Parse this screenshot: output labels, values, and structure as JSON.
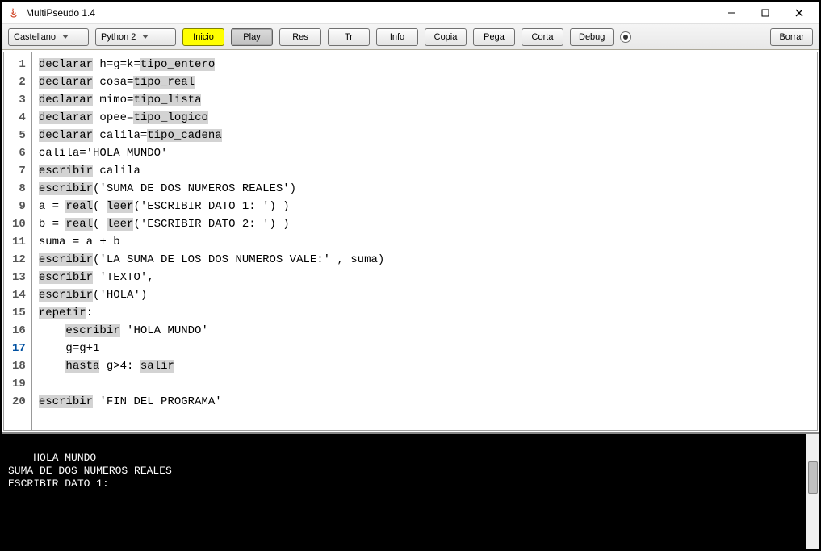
{
  "window": {
    "title": "MultiPseudo 1.4"
  },
  "toolbar": {
    "language": "Castellano",
    "interpreter": "Python 2",
    "inicio": "Inicio",
    "play": "Play",
    "res": "Res",
    "tr": "Tr",
    "info": "Info",
    "copia": "Copia",
    "pega": "Pega",
    "corta": "Corta",
    "debug": "Debug",
    "borrar": "Borrar"
  },
  "code": {
    "lines": [
      {
        "n": "1",
        "segs": [
          [
            "declarar",
            "kw"
          ],
          [
            " h=g=k=",
            ""
          ],
          [
            "tipo_entero",
            "kw"
          ]
        ]
      },
      {
        "n": "2",
        "segs": [
          [
            "declarar",
            "kw"
          ],
          [
            " cosa=",
            ""
          ],
          [
            "tipo_real",
            "kw"
          ]
        ]
      },
      {
        "n": "3",
        "segs": [
          [
            "declarar",
            "kw"
          ],
          [
            " mimo=",
            ""
          ],
          [
            "tipo_lista",
            "kw"
          ]
        ]
      },
      {
        "n": "4",
        "segs": [
          [
            "declarar",
            "kw"
          ],
          [
            " opee=",
            ""
          ],
          [
            "tipo_logico",
            "kw"
          ]
        ]
      },
      {
        "n": "5",
        "segs": [
          [
            "declarar",
            "kw"
          ],
          [
            " calila=",
            ""
          ],
          [
            "tipo_cadena",
            "kw"
          ]
        ]
      },
      {
        "n": "6",
        "segs": [
          [
            "calila='HOLA MUNDO'",
            ""
          ]
        ]
      },
      {
        "n": "7",
        "segs": [
          [
            "escribir",
            "kw"
          ],
          [
            " calila",
            ""
          ]
        ]
      },
      {
        "n": "8",
        "segs": [
          [
            "escribir",
            "kw"
          ],
          [
            "('SUMA DE DOS NUMEROS REALES')",
            ""
          ]
        ]
      },
      {
        "n": "9",
        "segs": [
          [
            "a = ",
            ""
          ],
          [
            "real",
            "kw"
          ],
          [
            "( ",
            ""
          ],
          [
            "leer",
            "kw"
          ],
          [
            "('ESCRIBIR DATO 1: ') )",
            ""
          ]
        ]
      },
      {
        "n": "10",
        "segs": [
          [
            "b = ",
            ""
          ],
          [
            "real",
            "kw"
          ],
          [
            "( ",
            ""
          ],
          [
            "leer",
            "kw"
          ],
          [
            "('ESCRIBIR DATO 2: ') )",
            ""
          ]
        ]
      },
      {
        "n": "11",
        "segs": [
          [
            "suma = a + b",
            ""
          ]
        ]
      },
      {
        "n": "12",
        "segs": [
          [
            "escribir",
            "kw"
          ],
          [
            "('LA SUMA DE LOS DOS NUMEROS VALE:' , suma)",
            ""
          ]
        ]
      },
      {
        "n": "13",
        "segs": [
          [
            "escribir",
            "kw"
          ],
          [
            " 'TEXTO',",
            ""
          ]
        ]
      },
      {
        "n": "14",
        "segs": [
          [
            "escribir",
            "kw"
          ],
          [
            "('HOLA')",
            ""
          ]
        ]
      },
      {
        "n": "15",
        "segs": [
          [
            "repetir",
            "kw"
          ],
          [
            ":",
            ""
          ]
        ]
      },
      {
        "n": "16",
        "segs": [
          [
            "    ",
            ""
          ],
          [
            "escribir",
            "kw"
          ],
          [
            " 'HOLA MUNDO'",
            ""
          ]
        ]
      },
      {
        "n": "17",
        "bp": true,
        "segs": [
          [
            "    g=g+1",
            ""
          ]
        ]
      },
      {
        "n": "18",
        "segs": [
          [
            "    ",
            ""
          ],
          [
            "hasta",
            "kw"
          ],
          [
            " g>4: ",
            ""
          ],
          [
            "salir",
            "kw"
          ]
        ]
      },
      {
        "n": "19",
        "segs": [
          [
            "",
            ""
          ]
        ]
      },
      {
        "n": "20",
        "segs": [
          [
            "escribir",
            "kw"
          ],
          [
            " 'FIN DEL PROGRAMA'",
            ""
          ]
        ]
      }
    ]
  },
  "console": {
    "output": "HOLA MUNDO\nSUMA DE DOS NUMEROS REALES\nESCRIBIR DATO 1: "
  }
}
